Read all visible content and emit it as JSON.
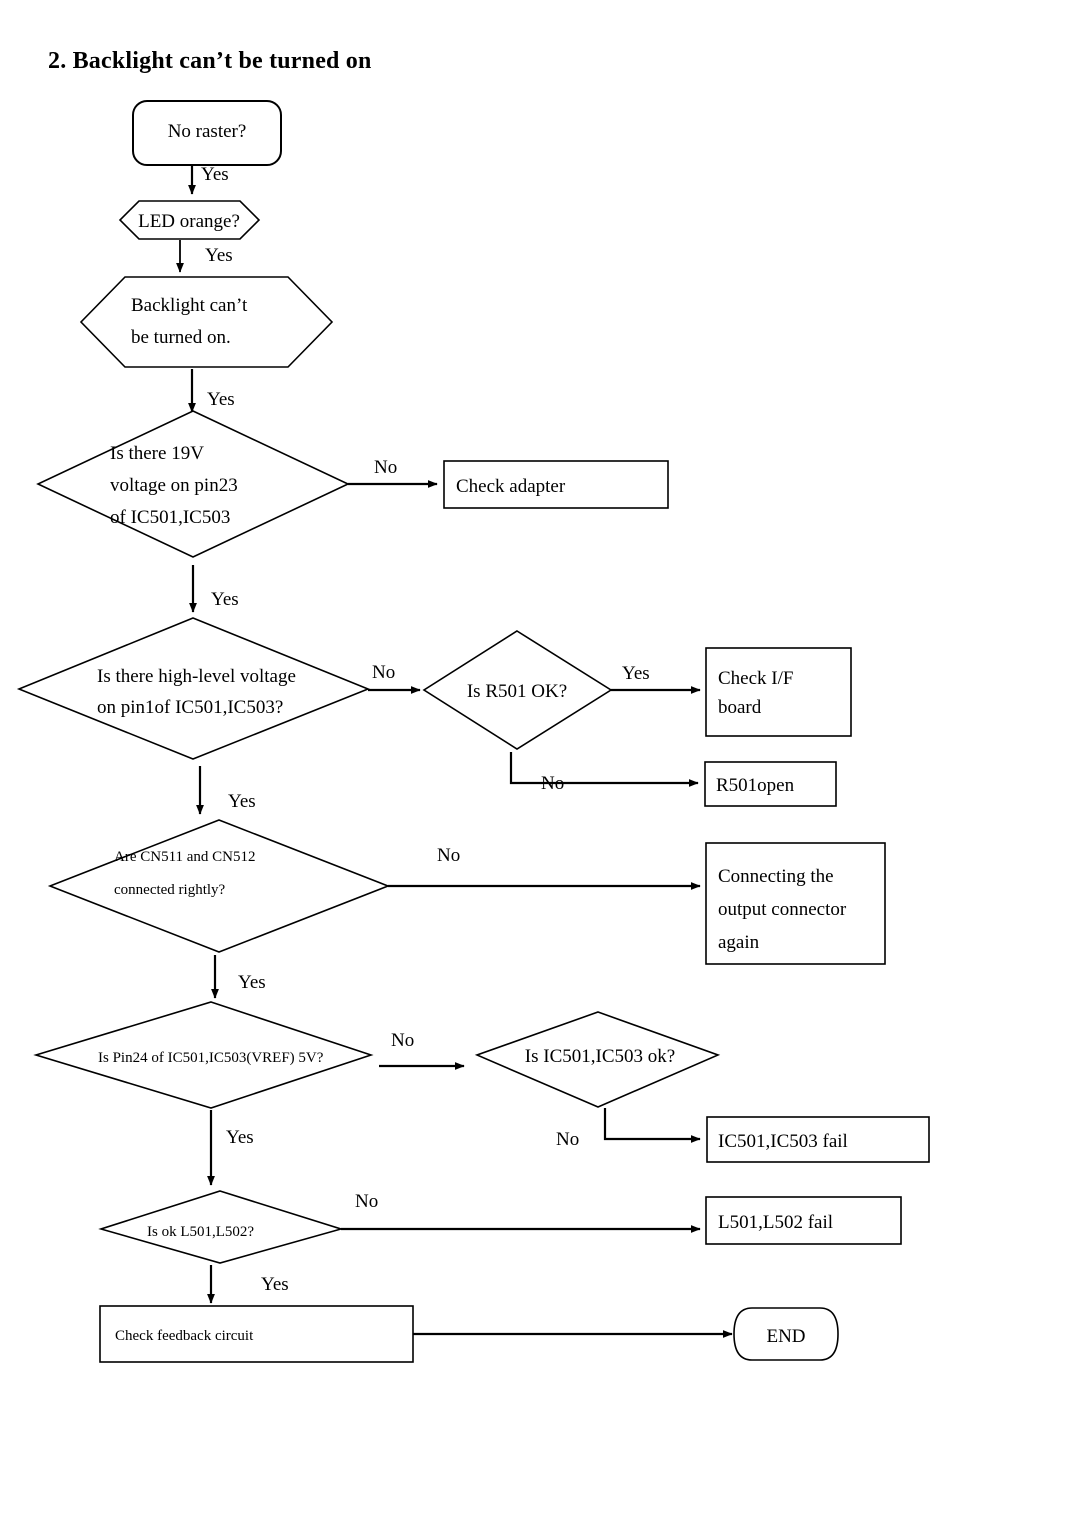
{
  "document": {
    "title": "2. Backlight can’t be turned on"
  },
  "flowchart": {
    "type": "flowchart",
    "orientation": "top-to-bottom",
    "nodes": [
      {
        "id": "no-raster",
        "shape": "rounded-rect",
        "lines": [
          "No raster?"
        ]
      },
      {
        "id": "led-orange",
        "shape": "hexagon",
        "lines": [
          "LED orange?"
        ]
      },
      {
        "id": "backlight-off",
        "shape": "hexagon",
        "lines": [
          "Backlight can’t",
          "be turned on."
        ]
      },
      {
        "id": "v19-pin23",
        "shape": "diamond",
        "lines": [
          "Is there 19V",
          "voltage on pin23",
          "of IC501,IC503"
        ]
      },
      {
        "id": "check-adapter",
        "shape": "rect",
        "lines": [
          "Check adapter"
        ]
      },
      {
        "id": "high-level-pin1",
        "shape": "diamond",
        "lines": [
          "Is there high-level voltage",
          "on pin1of IC501,IC503?"
        ]
      },
      {
        "id": "r501-ok",
        "shape": "diamond",
        "lines": [
          "Is R501 OK?"
        ]
      },
      {
        "id": "check-if-board",
        "shape": "rect",
        "lines": [
          "Check I/F",
          "board"
        ]
      },
      {
        "id": "r501-open",
        "shape": "rect",
        "lines": [
          "R501open"
        ]
      },
      {
        "id": "cn511-cn512",
        "shape": "diamond",
        "lines": [
          "Are CN511 and CN512",
          "connected rightly?"
        ]
      },
      {
        "id": "reconnect-output",
        "shape": "rect",
        "lines": [
          "Connecting the",
          "output connector",
          "again"
        ]
      },
      {
        "id": "pin24-vref",
        "shape": "diamond",
        "lines": [
          "Is Pin24 of IC501,IC503(VREF) 5V?"
        ]
      },
      {
        "id": "ic501-ic503-ok",
        "shape": "diamond",
        "lines": [
          "Is IC501,IC503 ok?"
        ]
      },
      {
        "id": "ic501-ic503-fail",
        "shape": "rect",
        "lines": [
          "IC501,IC503 fail"
        ]
      },
      {
        "id": "l501-l502-ok",
        "shape": "diamond",
        "lines": [
          "Is ok L501,L502?"
        ]
      },
      {
        "id": "l501-l502-fail",
        "shape": "rect",
        "lines": [
          "L501,L502 fail"
        ]
      },
      {
        "id": "check-feedback",
        "shape": "rect",
        "lines": [
          "Check feedback circuit"
        ]
      },
      {
        "id": "end",
        "shape": "terminator",
        "lines": [
          "END"
        ]
      }
    ],
    "edges": [
      {
        "from": "no-raster",
        "to": "led-orange",
        "label": "Yes"
      },
      {
        "from": "led-orange",
        "to": "backlight-off",
        "label": "Yes"
      },
      {
        "from": "backlight-off",
        "to": "v19-pin23",
        "label": "Yes"
      },
      {
        "from": "v19-pin23",
        "to": "check-adapter",
        "label": "No"
      },
      {
        "from": "v19-pin23",
        "to": "high-level-pin1",
        "label": "Yes"
      },
      {
        "from": "high-level-pin1",
        "to": "r501-ok",
        "label": "No"
      },
      {
        "from": "r501-ok",
        "to": "check-if-board",
        "label": "Yes"
      },
      {
        "from": "r501-ok",
        "to": "r501-open",
        "label": "No"
      },
      {
        "from": "high-level-pin1",
        "to": "cn511-cn512",
        "label": "Yes"
      },
      {
        "from": "cn511-cn512",
        "to": "reconnect-output",
        "label": "No"
      },
      {
        "from": "cn511-cn512",
        "to": "pin24-vref",
        "label": "Yes"
      },
      {
        "from": "pin24-vref",
        "to": "ic501-ic503-ok",
        "label": "No"
      },
      {
        "from": "ic501-ic503-ok",
        "to": "ic501-ic503-fail",
        "label": "No"
      },
      {
        "from": "pin24-vref",
        "to": "l501-l502-ok",
        "label": "Yes"
      },
      {
        "from": "l501-l502-ok",
        "to": "l501-l502-fail",
        "label": "No"
      },
      {
        "from": "l501-l502-ok",
        "to": "check-feedback",
        "label": "Yes"
      },
      {
        "from": "check-feedback",
        "to": "end",
        "label": ""
      }
    ],
    "labels": {
      "yes": "Yes",
      "no": "No"
    },
    "colors": {
      "stroke": "#000000",
      "fill": "#ffffff",
      "text": "#000000"
    }
  }
}
